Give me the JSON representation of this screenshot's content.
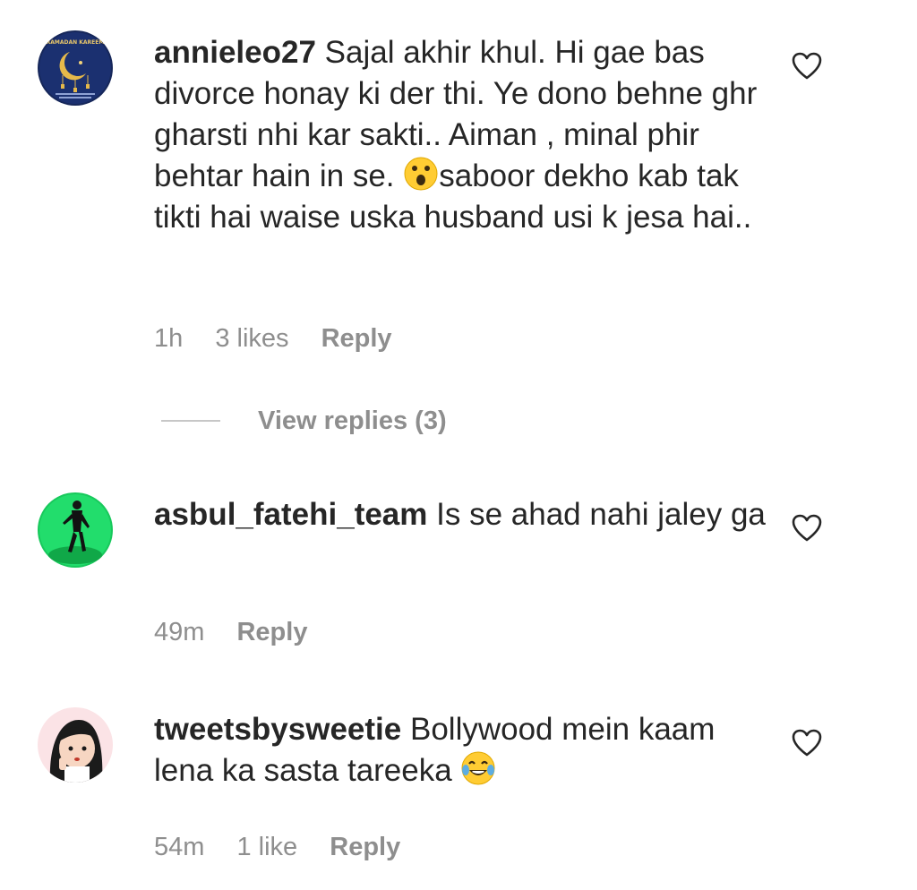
{
  "comments": [
    {
      "username": "annieleo27",
      "text_before_emoji": "Sajal akhir khul. Hi gae bas divorce honay ki der thi. Ye dono behne ghr gharsti nhi kar sakti.. Aiman , minal phir behtar hain in se. ",
      "emoji": "astonished-face-emoji",
      "text_after_emoji": "saboor dekho kab tak tikti hai waise uska husband usi k jesa hai..",
      "time": "1h",
      "likes": "3 likes",
      "reply_label": "Reply",
      "avatar": "ramadan-kareem-avatar",
      "avatar_banner_text": "RAMADAN KAREEM"
    },
    {
      "username": "asbul_fatehi_team",
      "text": "Is se ahad nahi jaley ga",
      "time": "49m",
      "reply_label": "Reply",
      "avatar": "dancer-green-avatar"
    },
    {
      "username": "tweetsbysweetie",
      "text": "Bollywood mein kaam lena ka sasta tareeka ",
      "emoji": "face-with-tears-of-joy-emoji",
      "time": "54m",
      "likes": "1 like",
      "reply_label": "Reply",
      "avatar": "cartoon-girl-avatar"
    }
  ],
  "view_replies_label": "View replies (3)",
  "colors": {
    "text": "#262626",
    "meta": "#8e8e8e",
    "divider": "#c7c7c7",
    "avatar1_bg": "#1a2b5c",
    "avatar2_bg": "#1fd46a",
    "avatar3_bg": "#fbe3e6"
  }
}
